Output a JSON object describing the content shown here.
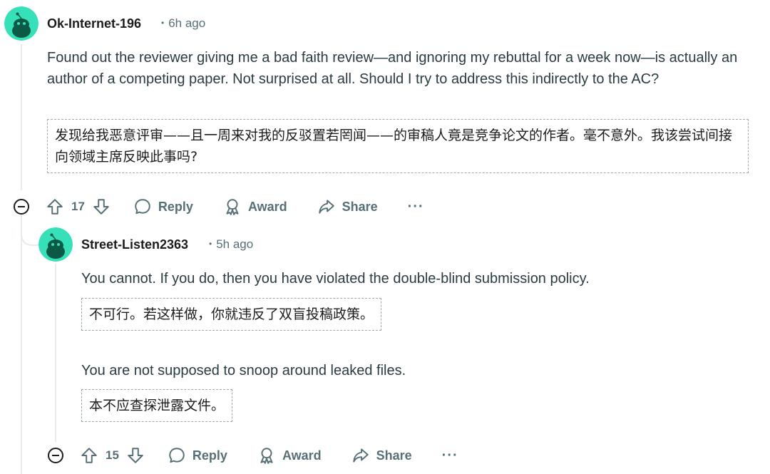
{
  "comments": [
    {
      "username": "Ok-Internet-196",
      "time": "6h ago",
      "body": "Found out the reviewer giving me a bad faith review—and ignoring my rebuttal for a week now—is actually an author of a competing paper. Not surprised at all. Should I try to address this indirectly to the AC?",
      "translation": "发现给我恶意评审——且一周来对我的反驳置若罔闻——的审稿人竟是竞争论文的作者。毫不意外。我该尝试间接向领域主席反映此事吗?",
      "votes": "17",
      "actions": {
        "reply": "Reply",
        "award": "Award",
        "share": "Share",
        "more": "···"
      }
    },
    {
      "username": "Street-Listen2363",
      "time": "5h ago",
      "paragraphs": [
        {
          "text": "You cannot. If you do, then you have violated the double-blind submission policy.",
          "translation": "不可行。若这样做，你就违反了双盲投稿政策。"
        },
        {
          "text": "You are not supposed to snoop around leaked files.",
          "translation": "本不应查探泄露文件。"
        }
      ],
      "votes": "15",
      "actions": {
        "reply": "Reply",
        "award": "Award",
        "share": "Share",
        "more": "···"
      }
    }
  ],
  "colors": {
    "avatar_bg": "#36e0b9",
    "avatar_face": "#0c5a45",
    "meta_text": "#576f76",
    "thread_line": "#e5ebee"
  }
}
